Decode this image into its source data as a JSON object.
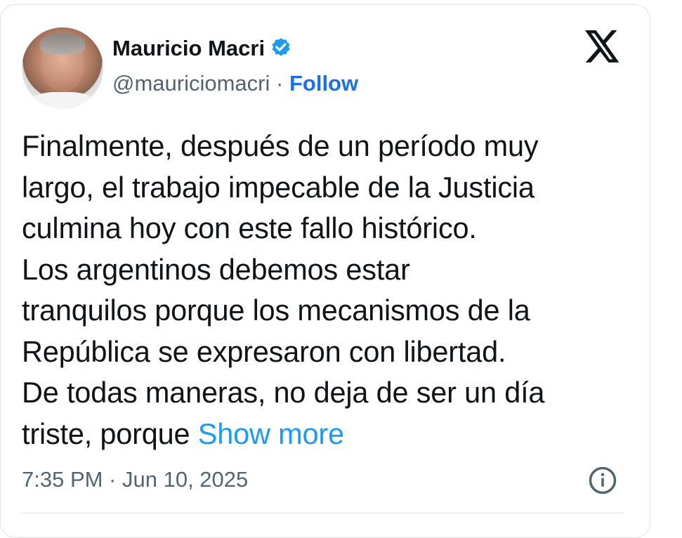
{
  "tweet": {
    "author": {
      "name": "Mauricio Macri",
      "handle": "@mauriciomacri",
      "separator": " · ",
      "follow_label": "Follow",
      "verified": true
    },
    "text": "Finalmente, después de un período muy\nlargo, el trabajo impecable de la Justicia\nculmina hoy con este fallo histórico.\nLos argentinos debemos estar\ntranquilos porque los mecanismos de la\nRepública se expresaron con libertad.\nDe todas maneras, no deja de ser un día\ntriste, porque ",
    "show_more_label": "Show more",
    "timestamp": "7:35 PM · Jun 10, 2025"
  },
  "icons": {
    "platform": "x-logo-icon",
    "verified": "verified-badge-icon",
    "info": "info-icon"
  },
  "colors": {
    "follow": "#1d6fe8",
    "show_more": "#1d9bf0",
    "verified": "#1d9bf0",
    "secondary_text": "#536471"
  }
}
